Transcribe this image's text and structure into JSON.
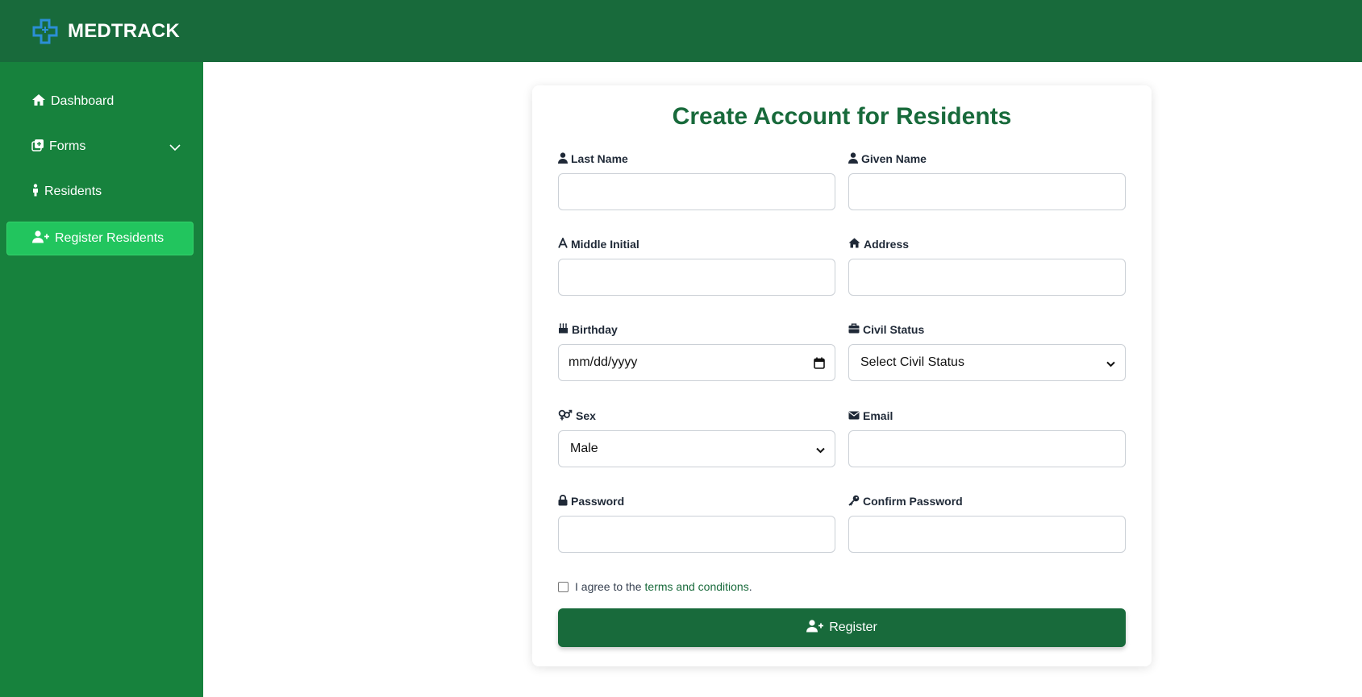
{
  "app": {
    "brand": "MEDTRACK"
  },
  "sidebar": {
    "items": [
      {
        "label": "Dashboard",
        "icon": "home-icon"
      },
      {
        "label": "Forms",
        "icon": "forms-icon"
      },
      {
        "label": "Residents",
        "icon": "person-icon"
      },
      {
        "label": "Register Residents",
        "icon": "user-plus-icon",
        "active": true
      }
    ]
  },
  "form": {
    "title": "Create Account for Residents",
    "fields": {
      "last_name": {
        "label": "Last Name",
        "value": ""
      },
      "given_name": {
        "label": "Given Name",
        "value": ""
      },
      "middle_initial": {
        "label": "Middle Initial",
        "value": ""
      },
      "address": {
        "label": "Address",
        "value": ""
      },
      "birthday": {
        "label": "Birthday",
        "placeholder": "mm/dd/yyyy"
      },
      "civil_status": {
        "label": "Civil Status",
        "selected": "Select Civil Status"
      },
      "sex": {
        "label": "Sex",
        "selected": "Male"
      },
      "email": {
        "label": "Email",
        "value": ""
      },
      "password": {
        "label": "Password",
        "value": ""
      },
      "confirm_password": {
        "label": "Confirm Password",
        "value": ""
      }
    },
    "agree": {
      "prefix": "I agree to the",
      "link": "terms and conditions",
      "suffix": "."
    },
    "submit_label": "Register"
  },
  "colors": {
    "header": "#186a3b",
    "sidebar": "#17823d",
    "active": "#22c55e",
    "accent": "#186a3b"
  }
}
